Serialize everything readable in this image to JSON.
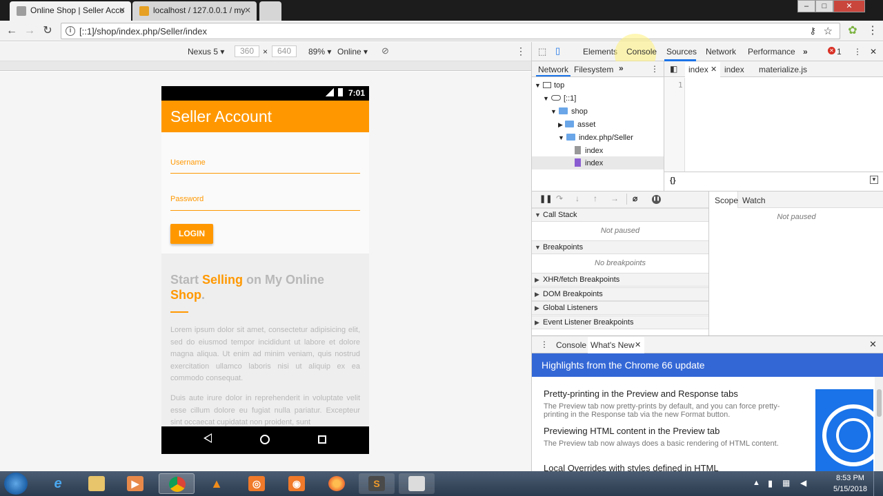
{
  "browser": {
    "tabs": [
      {
        "title": "Online Shop | Seller Acco",
        "active": true
      },
      {
        "title": "localhost / 127.0.0.1 / my",
        "active": false
      }
    ],
    "url": "[::1]/shop/index.php/Seller/index",
    "window_buttons": [
      "–",
      "□",
      "✕"
    ]
  },
  "device_toolbar": {
    "device": "Nexus 5",
    "width": "360",
    "separator": "×",
    "height": "640",
    "zoom": "89%",
    "throttle": "Online"
  },
  "phone": {
    "time": "7:01",
    "app_title": "Seller Account",
    "username_label": "Username",
    "password_label": "Password",
    "login_label": "LOGIN",
    "promo_title_parts": [
      "Start ",
      "Selling",
      " on My Online ",
      "Shop",
      "."
    ],
    "paragraph1": "Lorem ipsum dolor sit amet, consectetur adipisicing elit, sed do eiusmod tempor incididunt ut labore et dolore magna aliqua. Ut enim ad minim veniam, quis nostrud exercitation ullamco laboris nisi ut aliquip ex ea commodo consequat.",
    "paragraph2": "Duis aute irure dolor in reprehenderit in voluptate velit esse cillum dolore eu fugiat nulla pariatur. Excepteur sint occaecat cupidatat non proident, sunt"
  },
  "devtools": {
    "main_tabs": [
      "Elements",
      "Console",
      "Sources",
      "Network",
      "Performance"
    ],
    "error_count": "1",
    "left_tabs": [
      "Network",
      "Filesystem"
    ],
    "file_tree": [
      "top",
      "[::1]",
      "shop",
      "asset",
      "index.php/Seller",
      "index",
      "index"
    ],
    "editor_tabs": [
      "index",
      "index",
      "materialize.js"
    ],
    "line_number": "1",
    "format_label": "{}",
    "sections": {
      "call_stack": "Call Stack",
      "call_stack_note": "Not paused",
      "breakpoints": "Breakpoints",
      "breakpoints_note": "No breakpoints",
      "collapsed": [
        "XHR/fetch Breakpoints",
        "DOM Breakpoints",
        "Global Listeners",
        "Event Listener Breakpoints"
      ]
    },
    "scope_tabs": [
      "Scope",
      "Watch"
    ],
    "scope_note": "Not paused",
    "drawer_tabs": [
      "Console",
      "What's New"
    ],
    "whats_new": {
      "banner": "Highlights from the Chrome 66 update",
      "items": [
        {
          "title": "Pretty-printing in the Preview and Response tabs",
          "desc": "The Preview tab now pretty-prints by default, and you can force pretty-printing in the Response tab via the new Format button."
        },
        {
          "title": "Previewing HTML content in the Preview tab",
          "desc": "The Preview tab now always does a basic rendering of HTML content."
        },
        {
          "title": "Local Overrides with styles defined in HTML",
          "desc": ""
        }
      ]
    }
  },
  "taskbar": {
    "time": "8:53 PM",
    "date": "5/15/2018"
  },
  "colors": {
    "accent": "#ff9800",
    "banner": "#3367d6"
  }
}
